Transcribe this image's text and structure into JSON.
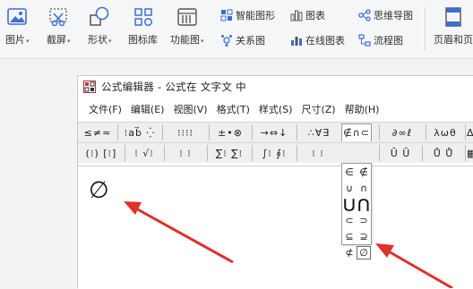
{
  "ribbon": {
    "picture": "图片",
    "screenshot": "截屏",
    "shape": "形状",
    "icon_lib": "图标库",
    "func_chart": "功能图",
    "smart_shape": "智能图形",
    "chart": "图表",
    "mind_map": "思维导图",
    "relation_chart": "关系图",
    "online_chart": "在线图表",
    "flowchart": "流程图",
    "header_footer": "页眉和页"
  },
  "editor": {
    "title": "公式编辑器 - 公式在 文字文 中",
    "menu": [
      "文件(F)",
      "编辑(E)",
      "视图(V)",
      "格式(T)",
      "样式(S)",
      "尺寸(Z)",
      "帮助(H)"
    ],
    "palette_row1": [
      "≤≠≈",
      "⁝ab⃗ ⁛",
      "⁝⁝⁝⁝",
      "±•⊗",
      "→⇔↓",
      "∴∀∃",
      "∉∩⊂",
      "∂∞ℓ",
      "λωθ",
      "ΔΩ"
    ],
    "palette_row2": [
      "(⁝) [⁝]",
      "⁝ √⁝",
      "⁝ ⁝",
      "∑⁝ ∑⁝",
      "∫⁝ ∮⁝",
      "⁝ ⁝",
      "→ ←",
      "Ū Ũ",
      "Ů Ů̈",
      "▦▦ ▦"
    ],
    "canvas_symbol": "∅",
    "dropdown_rows": [
      [
        "∈",
        "∉"
      ],
      [
        "∪",
        "∩"
      ],
      [
        "⋃",
        "⋂"
      ],
      [
        "⊂",
        "⊃"
      ],
      [
        "⊆",
        "⊇"
      ],
      [
        "⊄",
        "∅"
      ]
    ]
  },
  "colors": {
    "arrow": "#e0302a",
    "accent": "#3b6fd1"
  }
}
